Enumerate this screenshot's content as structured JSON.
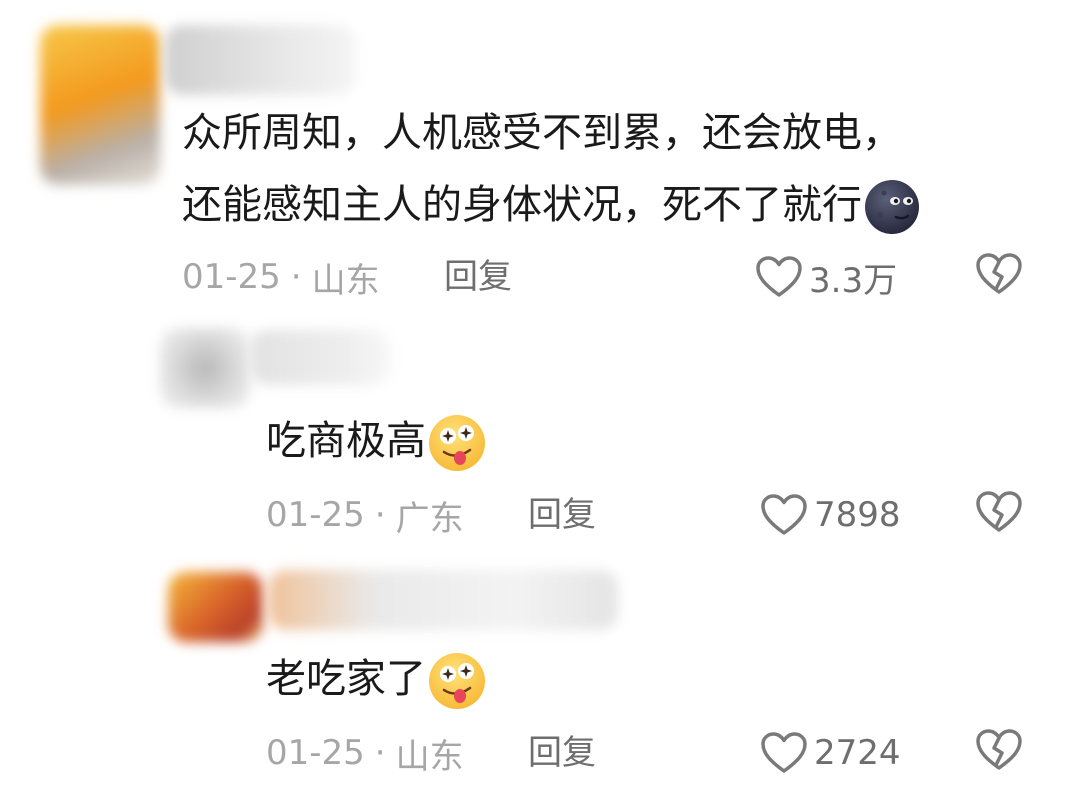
{
  "comments": [
    {
      "text_line1": "众所周知，人机感受不到累，还会放电，",
      "text_line2": "还能感知主人的身体状况，死不了就行",
      "emoji": "new-moon-face-emoji",
      "date": "01-25",
      "separator": "·",
      "location": "山东",
      "reply_label": "回复",
      "like_count": "3.3万"
    },
    {
      "text": "吃商极高",
      "emoji": "drooling-star-eyes-emoji",
      "date": "01-25",
      "separator": "·",
      "location": "广东",
      "reply_label": "回复",
      "like_count": "7898"
    },
    {
      "text": "老吃家了",
      "emoji": "drooling-star-eyes-emoji",
      "date": "01-25",
      "separator": "·",
      "location": "山东",
      "reply_label": "回复",
      "like_count": "2724"
    }
  ],
  "icons": {
    "like": "heart-outline-icon",
    "dislike": "broken-heart-icon"
  },
  "colors": {
    "text": "#1a1a1a",
    "meta": "#a6a6a6",
    "action": "#6e6e6e",
    "icon": "#7a7a7a"
  }
}
